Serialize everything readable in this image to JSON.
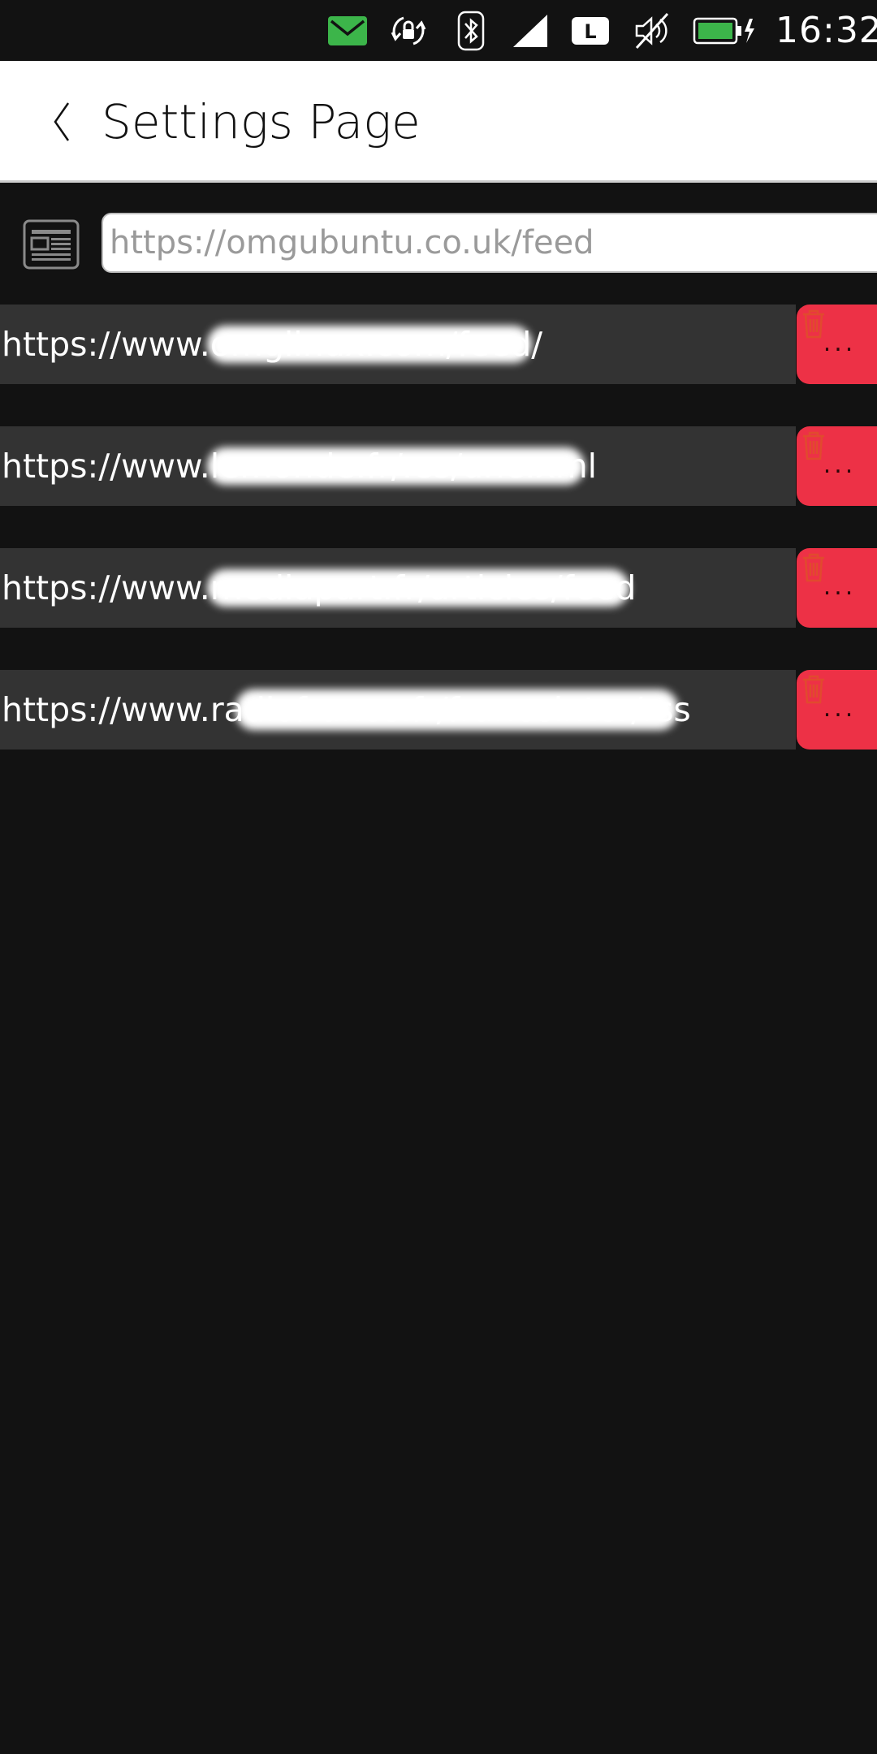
{
  "status_bar": {
    "time": "16:32",
    "network_label": "L",
    "icons": [
      "mail-icon",
      "rotation-lock-icon",
      "bluetooth-icon",
      "signal-icon",
      "network-type-icon",
      "volume-muted-icon",
      "battery-charging-icon"
    ],
    "mail_color": "#3cb54a",
    "battery_color": "#3cb54a"
  },
  "header": {
    "title": "Settings Page",
    "back_icon": "chevron-left-icon"
  },
  "add_feed": {
    "icon": "news-feed-icon",
    "placeholder": "https://omgubuntu.co.uk/feed"
  },
  "feeds": [
    {
      "url": "https://www.omglinux.com/feed/",
      "action_icon": "trash-icon",
      "action_label": "..."
    },
    {
      "url": "https://www.lemonde.fr/rss/une.xml",
      "action_icon": "trash-icon",
      "action_label": "..."
    },
    {
      "url": "https://www.mediapart.fr/articles/feed",
      "action_icon": "trash-icon",
      "action_label": "..."
    },
    {
      "url": "https://www.radiofrance.fr/franceinter/rss",
      "action_icon": "trash-icon",
      "action_label": "..."
    }
  ],
  "colors": {
    "background": "#121212",
    "header_background": "#ffffff",
    "row_background": "#333333",
    "delete_accent": "#ed3146"
  }
}
